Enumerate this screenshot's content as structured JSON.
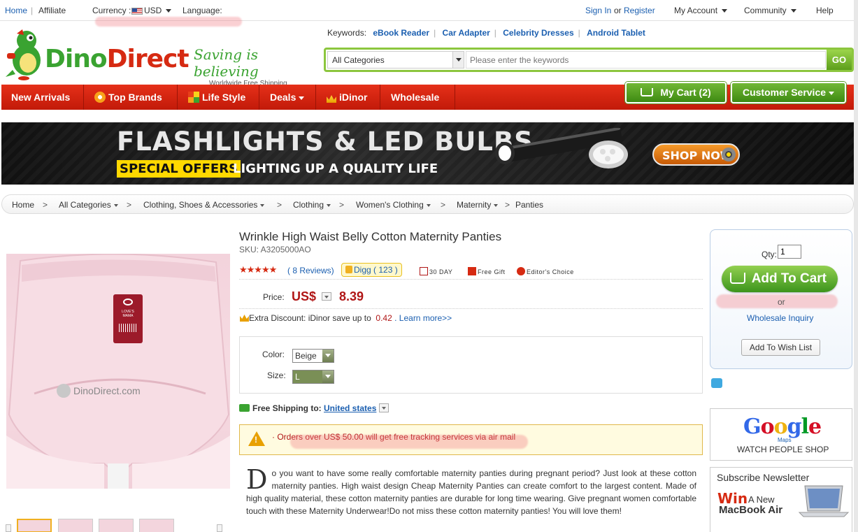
{
  "topbar": {
    "home": "Home",
    "affiliate": "Affiliate",
    "currency_label": "Currency :",
    "currency_value": "USD",
    "language_label": "Language:",
    "sign_in": "Sign In",
    "or": "or",
    "register": "Register",
    "my_account": "My Account",
    "community": "Community",
    "help": "Help"
  },
  "header": {
    "logo_part1": "Dino",
    "logo_part2": "Direct",
    "slogan": "Saving is believing",
    "slogan_sub": "Worldwide Free Shipping",
    "keywords_label": "Keywords:",
    "keywords": [
      "eBook Reader",
      "Car Adapter",
      "Celebrity Dresses",
      "Android Tablet"
    ],
    "search_category": "All Categories",
    "search_placeholder": "Please enter the keywords",
    "search_go": "GO"
  },
  "nav": {
    "items": [
      "New Arrivals",
      "Top Brands",
      "Life Style",
      "Deals",
      "iDinor",
      "Wholesale"
    ],
    "my_cart": "My Cart (2)",
    "customer_service": "Customer Service"
  },
  "banner": {
    "title": "FLASHLIGHTS & LED BULBS",
    "special": "SPECIAL OFFERS",
    "subtitle": "LIGHTING UP A QUALITY LIFE",
    "shop_now": "SHOP NOW"
  },
  "breadcrumb": [
    {
      "label": "Home",
      "dropdown": false
    },
    {
      "label": "All Categories",
      "dropdown": true
    },
    {
      "label": "Clothing, Shoes & Accessories",
      "dropdown": true
    },
    {
      "label": "Clothing",
      "dropdown": true
    },
    {
      "label": "Women's Clothing",
      "dropdown": true
    },
    {
      "label": "Maternity",
      "dropdown": true
    },
    {
      "label": "Panties",
      "dropdown": false
    }
  ],
  "product": {
    "title": "Wrinkle High Waist Belly Cotton Maternity Panties",
    "sku": "SKU: A3205000AO",
    "stars": "★★★★★",
    "rating": 5,
    "reviews": "( 8 Reviews)",
    "digg": "Digg ( 123 )",
    "badges": [
      "30 DAY",
      "Free Gift",
      "Editor's Choice"
    ],
    "price_label": "Price:",
    "currency": "US$",
    "price": "8.39",
    "extra_discount_text": "Extra Discount: iDinor save up to",
    "extra_discount_amount": "0.42",
    "learn_more": ". Learn more>>",
    "color_label": "Color:",
    "color_value": "Beige",
    "size_label": "Size:",
    "size_value": "L",
    "free_shipping_label": "Free Shipping to:",
    "ship_to": "United states",
    "notice": "· Orders over US$ 50.00 will get free tracking services via air mail",
    "image_watermark": "DinoDirect.com",
    "tag_text": "LOVE'S MAMA",
    "desc_cap": "D",
    "description": "o you want to have some really comfortable maternity panties during pregnant period? Just look at these cotton maternity panties. High waist design Cheap Maternity Panties can create comfort to the largest content. Made of high quality material, these cotton maternity panties are durable for long time wearing. Give pregnant women comfortable touch with these Maternity Underwear!Do not miss these cotton maternity panties! You will love them!"
  },
  "cartbox": {
    "qty_label": "Qty:",
    "qty_value": "1",
    "add_to_cart": "Add To Cart",
    "or": "or",
    "wholesale_inquiry": "Wholesale Inquiry",
    "add_to_wishlist": "Add To Wish List"
  },
  "sidebar": {
    "google_logo": "Google",
    "google_maps": "Maps",
    "google_caption": "WATCH PEOPLE SHOP",
    "newsletter_title": "Subscribe Newsletter",
    "newsletter_win": "Win",
    "newsletter_anew": "A New",
    "newsletter_prize": "MacBook Air"
  },
  "colors": {
    "brand_red": "#d62a12",
    "brand_green": "#3aa331",
    "link_blue": "#1b5fb0",
    "price_red": "#b01616"
  }
}
